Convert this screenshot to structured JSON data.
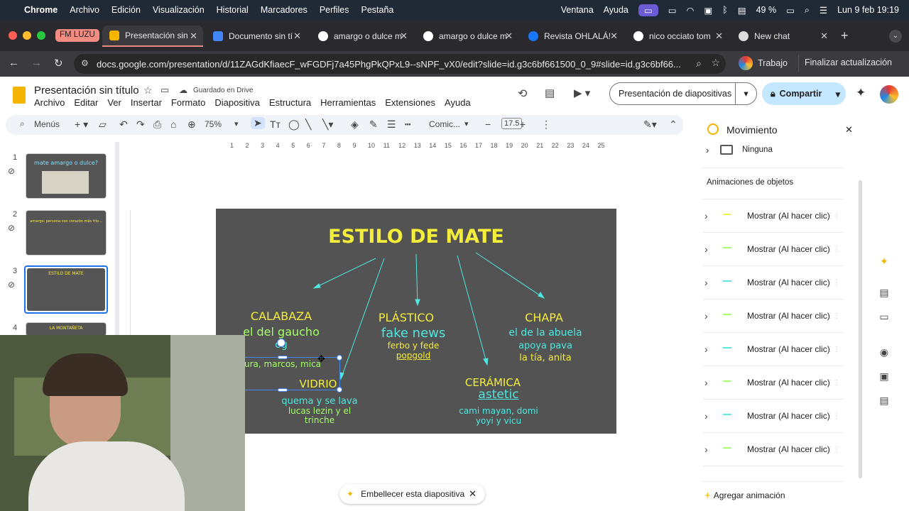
{
  "menubar": {
    "apple": "",
    "items": [
      "Chrome",
      "Archivo",
      "Edición",
      "Visualización",
      "Historial",
      "Marcadores",
      "Perfiles",
      "Pestaña"
    ],
    "right_items": [
      "Ventana",
      "Ayuda"
    ],
    "battery": "49 %",
    "datetime": "Lun 9 feb 19:19"
  },
  "tabs": {
    "group_label": "FM LUZU",
    "items": [
      {
        "title": "Presentación sin",
        "favicon_color": "#f4b400"
      },
      {
        "title": "Documento sin tí",
        "favicon_color": "#4285f4"
      },
      {
        "title": "amargo o dulce m",
        "favicon_color": "#ffffff"
      },
      {
        "title": "amargo o dulce m",
        "favicon_color": "#ffffff"
      },
      {
        "title": "Revista OHLALÁ!",
        "favicon_color": "#1877f2"
      },
      {
        "title": "nico occiato tom",
        "favicon_color": "#ffffff"
      },
      {
        "title": "New chat",
        "favicon_color": "#dddddd"
      }
    ],
    "new_tab": "+"
  },
  "address": {
    "url": "docs.google.com/presentation/d/11ZAGdKfiaecF_wFGDFj7a45PhgPkQPxL9--sNPF_vX0/edit?slide=id.g3c6bf661500_0_9#slide=id.g3c6bf66...",
    "profile": "Trabajo",
    "update_button": "Finalizar actualización"
  },
  "doc": {
    "title": "Presentación sin título",
    "saved_status": "Guardado en Drive",
    "menus": [
      "Archivo",
      "Editar",
      "Ver",
      "Insertar",
      "Formato",
      "Diapositiva",
      "Estructura",
      "Herramientas",
      "Extensiones",
      "Ayuda"
    ],
    "slideshow_button": "Presentación de diapositivas",
    "share_button": "Compartir"
  },
  "toolbar": {
    "menus_label": "Menús",
    "zoom": "75%",
    "font": "Comic...",
    "font_size": "17.5"
  },
  "filmstrip": {
    "slides": [
      {
        "num": "1",
        "title": "mate amargo o dulce?"
      },
      {
        "num": "2",
        "title": "amargo: persona con corazón más frío..."
      },
      {
        "num": "3",
        "title": "ESTILO DE MATE"
      },
      {
        "num": "4",
        "title": "LA MONTAÑETA"
      }
    ],
    "active": 3
  },
  "ruler": {
    "ticks": [
      "1",
      "2",
      "3",
      "4",
      "5",
      "6",
      "7",
      "8",
      "9",
      "10",
      "11",
      "12",
      "13",
      "14",
      "15",
      "16",
      "17",
      "18",
      "19",
      "20",
      "21",
      "22",
      "23",
      "24",
      "25"
    ]
  },
  "slide": {
    "title": "ESTILO DE MATE",
    "calabaza": {
      "heading": "CALABAZA",
      "sub": "el del gaucho",
      "extra": "og",
      "names": "ura, marcos, mica"
    },
    "vidrio": {
      "heading": "VIDRIO",
      "desc": "quema y se lava",
      "names1": "lucas lezin y el",
      "names2": "trinche"
    },
    "plastico": {
      "heading": "PLÁSTICO",
      "sub": "fake news",
      "names1": "ferbo y fede",
      "names2": "popgold"
    },
    "chapa": {
      "heading": "CHAPA",
      "sub": "el de la abuela",
      "line2": "apoya pava",
      "names": "la tía, anita"
    },
    "ceramica": {
      "heading": "CERÁMICA",
      "sub": "astetic",
      "names1": "cami mayan, domi",
      "names2": "yoyi y vicu"
    }
  },
  "panel": {
    "title": "Movimiento",
    "transition": "Ninguna",
    "section": "Animaciones de objetos",
    "animations": [
      {
        "label": "Mostrar  (Al hacer clic)",
        "swatch": "#f4ee3a"
      },
      {
        "label": "Mostrar  (Al hacer clic)",
        "swatch": "#a3ff66"
      },
      {
        "label": "Mostrar  (Al hacer clic)",
        "swatch": "#4ee8e0"
      },
      {
        "label": "Mostrar  (Al hacer clic)",
        "swatch": "#a3ff66"
      },
      {
        "label": "Mostrar  (Al hacer clic)",
        "swatch": "#4ee8e0"
      },
      {
        "label": "Mostrar  (Al hacer clic)",
        "swatch": "#a3ff66"
      },
      {
        "label": "Mostrar  (Al hacer clic)",
        "swatch": "#4ee8e0"
      },
      {
        "label": "Mostrar  (Al hacer clic)",
        "swatch": "#a3ff66"
      }
    ],
    "add_button": "Agregar animación"
  },
  "beautify": {
    "label": "Embellecer esta diapositiva"
  },
  "colors": {
    "accent": "#1a73e8",
    "slide_bg": "#535353",
    "yellow": "#f4ee3a",
    "green": "#a3ff66",
    "cyan": "#4ee8e0"
  }
}
